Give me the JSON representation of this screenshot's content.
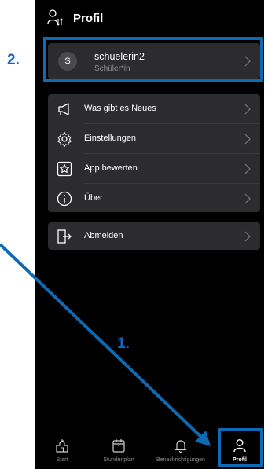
{
  "header": {
    "title": "Profil",
    "icon": "person-sort-icon"
  },
  "user": {
    "avatar_initial": "S",
    "name": "schuelerin2",
    "role": "Schüler*in"
  },
  "menu": [
    {
      "label": "Was gibt es Neues",
      "icon": "megaphone-icon"
    },
    {
      "label": "Einstellungen",
      "icon": "gear-icon"
    },
    {
      "label": "App bewerten",
      "icon": "star-icon"
    },
    {
      "label": "Über",
      "icon": "info-icon"
    }
  ],
  "logout": {
    "label": "Abmelden",
    "icon": "logout-icon"
  },
  "tabs": [
    {
      "label": "Start",
      "icon": "school-icon",
      "active": false
    },
    {
      "label": "Stundenplan",
      "icon": "calendar-icon",
      "active": false
    },
    {
      "label": "Benachrichtigungen",
      "icon": "bell-icon",
      "active": false
    },
    {
      "label": "Profil",
      "icon": "person-icon",
      "active": true
    }
  ],
  "annotations": {
    "step1": "1.",
    "step2": "2."
  },
  "colors": {
    "accent": "#0f6ab4",
    "card": "#2c2c2e",
    "background": "#000000"
  }
}
